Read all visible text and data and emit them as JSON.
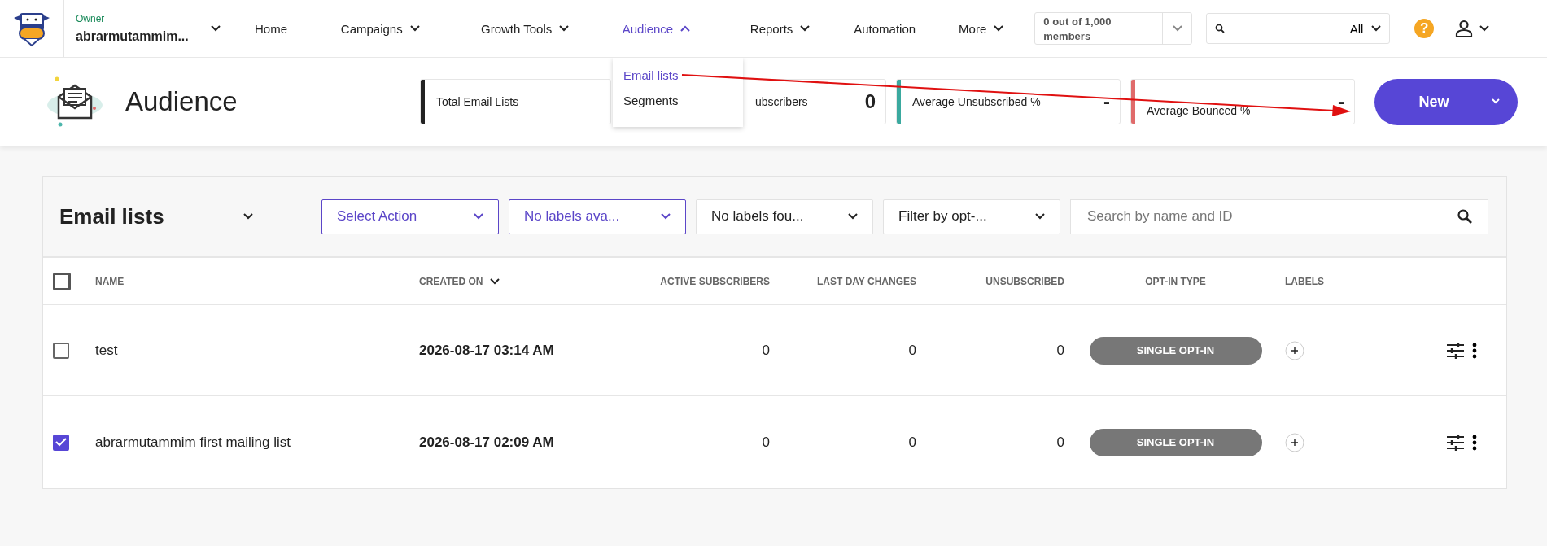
{
  "topbar": {
    "role": "Owner",
    "account": "abrarmutammim...",
    "nav": [
      {
        "label": "Home",
        "dropdown": false,
        "selected": false
      },
      {
        "label": "Campaigns",
        "dropdown": true,
        "selected": false
      },
      {
        "label": "Growth Tools",
        "dropdown": true,
        "selected": false
      },
      {
        "label": "Audience",
        "dropdown": true,
        "selected": true
      },
      {
        "label": "Reports",
        "dropdown": true,
        "selected": false
      },
      {
        "label": "Automation",
        "dropdown": false,
        "selected": false
      },
      {
        "label": "More",
        "dropdown": true,
        "selected": false
      }
    ],
    "members": "0 out of 1,000 members",
    "search_scope": "All",
    "help": "?"
  },
  "nav_menu": [
    {
      "label": "Email lists",
      "selected": true
    },
    {
      "label": "Segments",
      "selected": false
    }
  ],
  "header": {
    "title": "Audience",
    "stats": [
      {
        "label": "Total Email Lists",
        "color": "#222222"
      },
      {
        "label": "ubscribers",
        "value": "0"
      },
      {
        "label": "Average Unsubscribed %",
        "value": "-",
        "color": "#3aa99f"
      },
      {
        "label": "Average Bounced %",
        "value": "-",
        "color": "#e06b6b"
      }
    ],
    "new_button": "New"
  },
  "panel": {
    "title": "Email lists",
    "filters": [
      {
        "text": "Select Action",
        "highlighted": true
      },
      {
        "text": "No labels ava...",
        "highlighted": true
      },
      {
        "text": "No labels fou...",
        "highlighted": false
      },
      {
        "text": "Filter by opt-...",
        "highlighted": false
      }
    ],
    "search": {
      "placeholder": "Search by name and ID"
    },
    "select_all_checked": false,
    "columns": [
      {
        "label": "NAME",
        "sorted": false
      },
      {
        "label": "CREATED ON",
        "sorted": true
      },
      {
        "label": "ACTIVE SUBSCRIBERS",
        "sorted": false
      },
      {
        "label": "LAST DAY CHANGES",
        "sorted": false
      },
      {
        "label": "UNSUBSCRIBED",
        "sorted": false
      },
      {
        "label": "OPT-IN TYPE",
        "sorted": false
      },
      {
        "label": "LABELS",
        "sorted": false
      }
    ],
    "rows": [
      {
        "checked": false,
        "name": "test",
        "created_on": "2026-08-17 03:14 AM",
        "active_subscribers": "0",
        "last_day_changes": "0",
        "unsubscribed": "0",
        "opt_in_type": "SINGLE OPT-IN"
      },
      {
        "checked": true,
        "name": "abrarmutammim first mailing list",
        "created_on": "2026-08-17 02:09 AM",
        "active_subscribers": "0",
        "last_day_changes": "0",
        "unsubscribed": "0",
        "opt_in_type": "SINGLE OPT-IN"
      }
    ]
  }
}
